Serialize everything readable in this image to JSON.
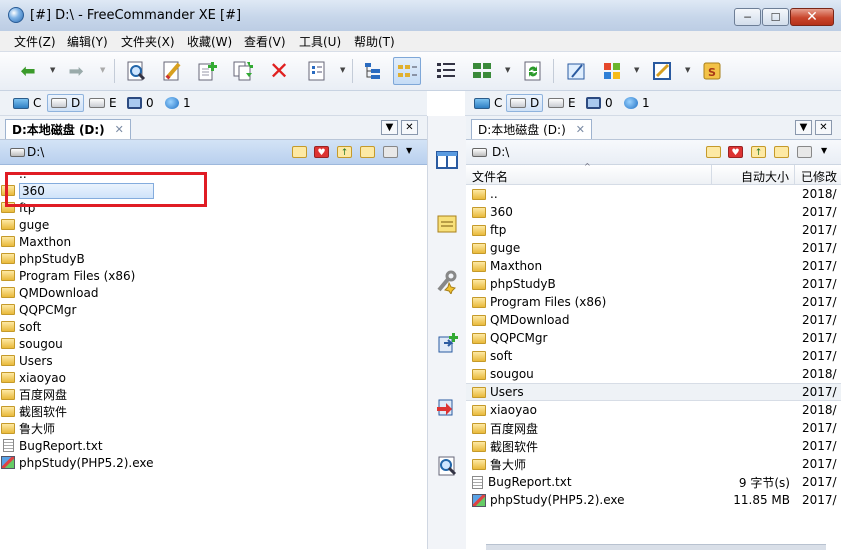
{
  "window": {
    "title": "[#] D:\\ - FreeCommander XE [#]",
    "min_glyph": "─",
    "max_glyph": "☐",
    "close_glyph": "✕"
  },
  "menu": [
    "文件(Z)",
    "编辑(Y)",
    "文件夹(X)",
    "收藏(W)",
    "查看(V)",
    "工具(U)",
    "帮助(T)"
  ],
  "toolbar": {
    "icons": [
      "back-arrow-icon",
      "forward-arrow-icon",
      "view-file-icon",
      "edit-file-icon",
      "new-file-icon",
      "copy-file-icon",
      "delete-icon",
      "properties-icon",
      "tree-view-icon",
      "list-view-icon",
      "details-view-icon",
      "thumbnail-view-icon",
      "refresh-icon",
      "command-icon",
      "windows-icon",
      "notepad-icon",
      "settings-icon"
    ]
  },
  "drives": {
    "items": [
      {
        "label": "C",
        "kind": "system"
      },
      {
        "label": "D",
        "kind": "disk"
      },
      {
        "label": "E",
        "kind": "disk"
      },
      {
        "label": "0",
        "kind": "monitor"
      },
      {
        "label": "1",
        "kind": "network"
      }
    ],
    "selected": "D"
  },
  "left_panel": {
    "tab_label": "D:本地磁盘 (D:)",
    "path": "D:\\",
    "items": [
      {
        "name": "..",
        "type": "up"
      },
      {
        "name": "360",
        "type": "folder"
      },
      {
        "name": "ftp",
        "type": "folder"
      },
      {
        "name": "guge",
        "type": "folder"
      },
      {
        "name": "Maxthon",
        "type": "folder"
      },
      {
        "name": "phpStudyB",
        "type": "folder"
      },
      {
        "name": "Program Files (x86)",
        "type": "folder"
      },
      {
        "name": "QMDownload",
        "type": "folder"
      },
      {
        "name": "QQPCMgr",
        "type": "folder"
      },
      {
        "name": "soft",
        "type": "folder"
      },
      {
        "name": "sougou",
        "type": "folder"
      },
      {
        "name": "Users",
        "type": "folder"
      },
      {
        "name": "xiaoyao",
        "type": "folder"
      },
      {
        "name": "百度网盘",
        "type": "folder"
      },
      {
        "name": "截图软件",
        "type": "folder"
      },
      {
        "name": "鲁大师",
        "type": "folder"
      },
      {
        "name": "BugReport.txt",
        "type": "file"
      },
      {
        "name": "phpStudy(PHP5.2).exe",
        "type": "exe"
      }
    ],
    "selected_item": "360"
  },
  "right_panel": {
    "tab_label": "D:本地磁盘 (D:)",
    "path": "D:\\",
    "columns": {
      "name": "文件名",
      "size": "自动大小",
      "date": "已修改"
    },
    "items": [
      {
        "name": "..",
        "type": "folder",
        "size": "",
        "date": "2018/"
      },
      {
        "name": "360",
        "type": "folder",
        "size": "",
        "date": "2017/"
      },
      {
        "name": "ftp",
        "type": "folder",
        "size": "",
        "date": "2017/"
      },
      {
        "name": "guge",
        "type": "folder",
        "size": "",
        "date": "2017/"
      },
      {
        "name": "Maxthon",
        "type": "folder",
        "size": "",
        "date": "2017/"
      },
      {
        "name": "phpStudyB",
        "type": "folder",
        "size": "",
        "date": "2017/"
      },
      {
        "name": "Program Files (x86)",
        "type": "folder",
        "size": "",
        "date": "2017/"
      },
      {
        "name": "QMDownload",
        "type": "folder",
        "size": "",
        "date": "2017/"
      },
      {
        "name": "QQPCMgr",
        "type": "folder",
        "size": "",
        "date": "2017/"
      },
      {
        "name": "soft",
        "type": "folder",
        "size": "",
        "date": "2017/"
      },
      {
        "name": "sougou",
        "type": "folder",
        "size": "",
        "date": "2018/"
      },
      {
        "name": "Users",
        "type": "folder",
        "size": "",
        "date": "2017/"
      },
      {
        "name": "xiaoyao",
        "type": "folder",
        "size": "",
        "date": "2018/"
      },
      {
        "name": "百度网盘",
        "type": "folder",
        "size": "",
        "date": "2017/"
      },
      {
        "name": "截图软件",
        "type": "folder",
        "size": "",
        "date": "2017/"
      },
      {
        "name": "鲁大师",
        "type": "folder",
        "size": "",
        "date": "2017/"
      },
      {
        "name": "BugReport.txt",
        "type": "file",
        "size": "9 字节(s)",
        "date": "2017/"
      },
      {
        "name": "phpStudy(PHP5.2).exe",
        "type": "exe",
        "size": "11.85 MB",
        "date": "2017/"
      }
    ],
    "focused_item": "Users"
  },
  "middle_toolbar": {
    "icons": [
      "compare-icon",
      "notes-icon",
      "tools-icon",
      "copy-to-icon",
      "move-to-icon",
      "search-icon"
    ]
  },
  "colors": {
    "highlight_box": "#e01c24",
    "path_bar": "#c6daf2",
    "selection": "#cfe3fa"
  }
}
